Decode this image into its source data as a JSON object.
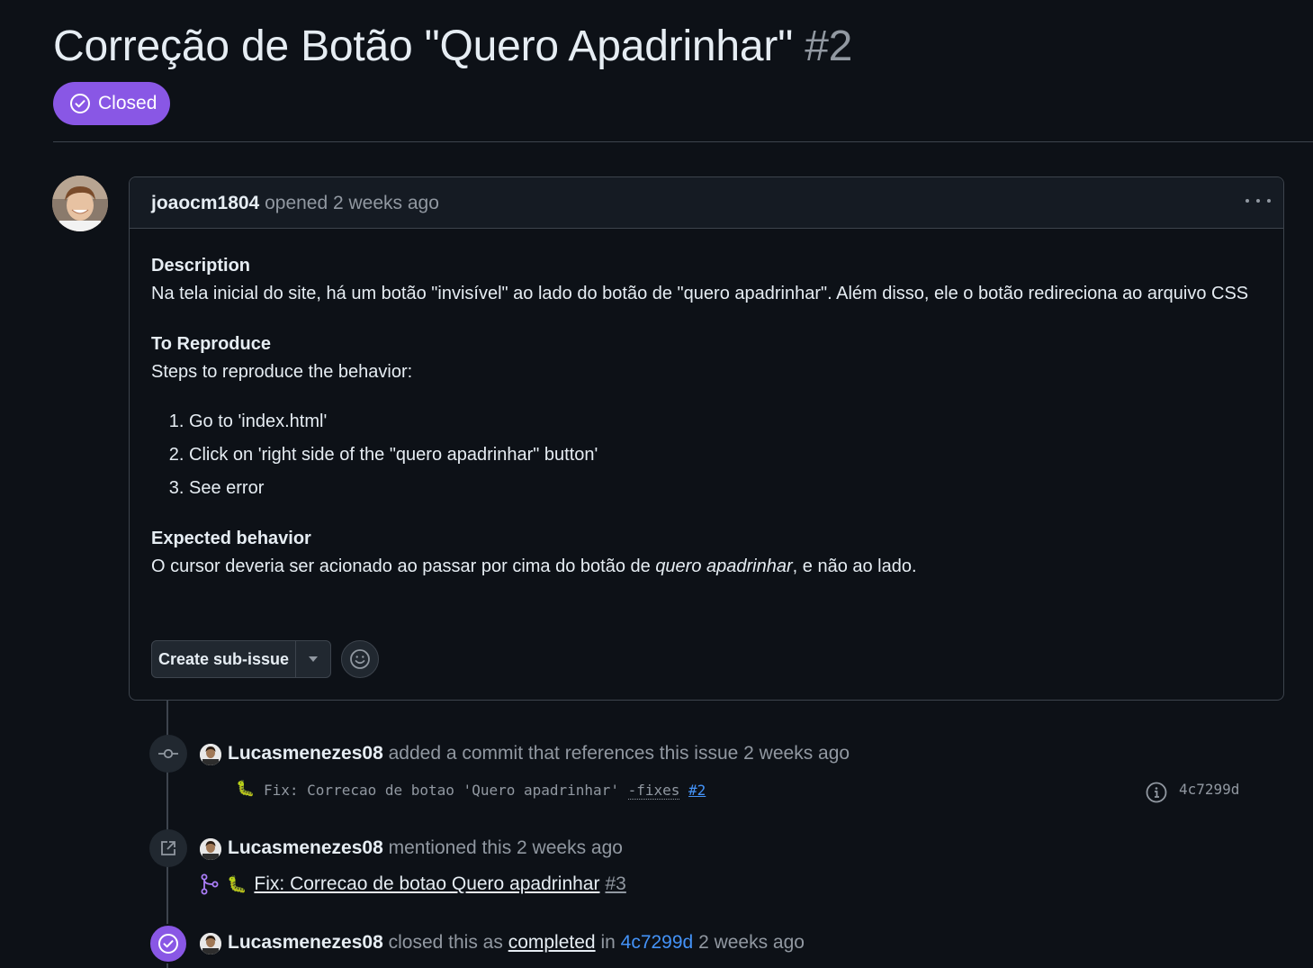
{
  "issue": {
    "title": "Correção de Botão \"Quero Apadrinhar\"",
    "number": "#2",
    "state": "Closed",
    "state_color": "#8957e5"
  },
  "comment": {
    "author": "joaocm1804",
    "action": "opened 2 weeks ago",
    "menu_icon": "kebab-horizontal-icon",
    "sections": {
      "description_heading": "Description",
      "description_text": "Na tela inicial do site, há um botão \"invisível\" ao lado do botão de \"quero apadrinhar\". Além disso, ele o botão redireciona ao arquivo CSS",
      "reproduce_heading": "To Reproduce",
      "reproduce_intro": "Steps to reproduce the behavior:",
      "steps": [
        "Go to 'index.html'",
        "Click on 'right side of the \"quero apadrinhar\" button'",
        "See error"
      ],
      "expected_heading": "Expected behavior",
      "expected_before": "O cursor deveria ser acionado ao passar por cima do botão de ",
      "expected_em": "quero apadrinhar",
      "expected_after": ", e não ao lado."
    },
    "buttons": {
      "create_sub_issue": "Create sub-issue",
      "dropdown_icon": "triangle-down-icon",
      "reaction_icon": "smiley-icon"
    }
  },
  "timeline": {
    "commit_event": {
      "author": "Lucasmenezes08",
      "text": "added a commit that references this issue 2 weeks ago",
      "message_prefix": "Fix: Correcao de botao 'Quero apadrinhar' ",
      "message_dotted": "-fixes",
      "message_ref": "#2",
      "sha": "4c7299d",
      "emoji": "🐛"
    },
    "mention_event": {
      "author": "Lucasmenezes08",
      "text": "mentioned this 2 weeks ago",
      "pr_title": "Fix: Correcao de botao Quero apadrinhar",
      "pr_number": "#3",
      "emoji": "🐛"
    },
    "closed_event": {
      "author": "Lucasmenezes08",
      "text_1": "closed this as",
      "completed": "completed",
      "text_2": "in",
      "sha": "4c7299d",
      "text_3": "2 weeks ago"
    }
  },
  "colors": {
    "background": "#0d1117",
    "border": "#3d444d",
    "muted": "#9198a1",
    "link": "#4493f8",
    "done_purple": "#8957e5"
  }
}
